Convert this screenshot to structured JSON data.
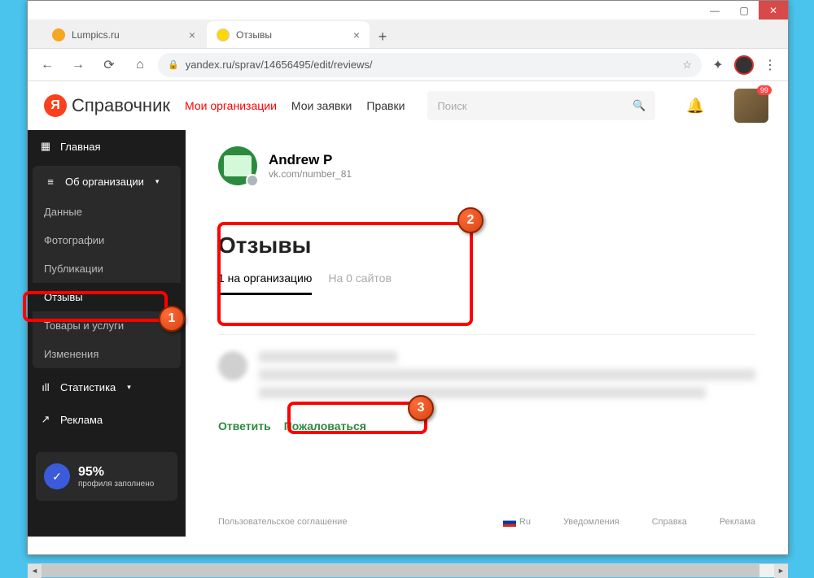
{
  "window": {
    "tabs": [
      {
        "title": "Lumpics.ru",
        "active": false
      },
      {
        "title": "Отзывы",
        "active": true
      }
    ]
  },
  "addressbar": {
    "url": "yandex.ru/sprav/14656495/edit/reviews/"
  },
  "yandex_header": {
    "logo_text": "Справочник",
    "nav": {
      "my_orgs": "Мои организации",
      "my_requests": "Мои заявки",
      "edits": "Правки"
    },
    "search_placeholder": "Поиск",
    "notifications_count": "99"
  },
  "sidebar": {
    "home": "Главная",
    "about_org": "Об организации",
    "subitems": {
      "data": "Данные",
      "photos": "Фотографии",
      "publications": "Публикации",
      "reviews": "Отзывы",
      "products": "Товары и услуги",
      "changes": "Изменения"
    },
    "stats": "Статистика",
    "ads": "Реклама",
    "profile_pct": "95%",
    "profile_label": "профиля заполнено"
  },
  "main": {
    "org_name": "Andrew P",
    "org_sub": "vk.com/number_81",
    "reviews_title": "Отзывы",
    "tab_org": "1 на организацию",
    "tab_sites": "На 0 сайтов",
    "action_reply": "Ответить",
    "action_report": "Пожаловаться"
  },
  "footer": {
    "agreement": "Пользовательское соглашение",
    "lang": "Ru",
    "notifications": "Уведомления",
    "help": "Справка",
    "ads": "Реклама"
  },
  "markers": {
    "one": "1",
    "two": "2",
    "three": "3"
  }
}
